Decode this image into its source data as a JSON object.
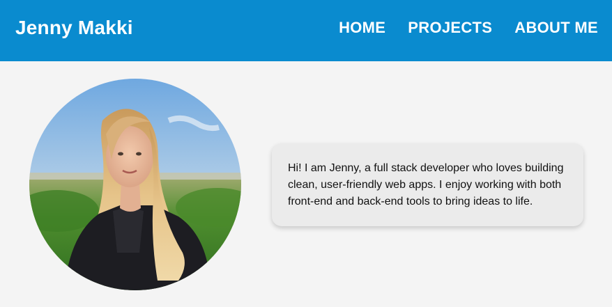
{
  "header": {
    "brand": "Jenny Makki",
    "nav": [
      {
        "label": "HOME"
      },
      {
        "label": "PROJECTS"
      },
      {
        "label": "ABOUT ME"
      }
    ],
    "bg_color": "#0a8bcf"
  },
  "profile": {
    "photo_alt": "",
    "bio": "Hi! I am Jenny, a full stack developer who loves building clean, user-friendly web apps. I enjoy working with both front-end and back-end tools to bring ideas to life."
  },
  "colors": {
    "page_bg": "#f4f4f4",
    "card_bg": "#ebebeb",
    "text": "#111111"
  }
}
